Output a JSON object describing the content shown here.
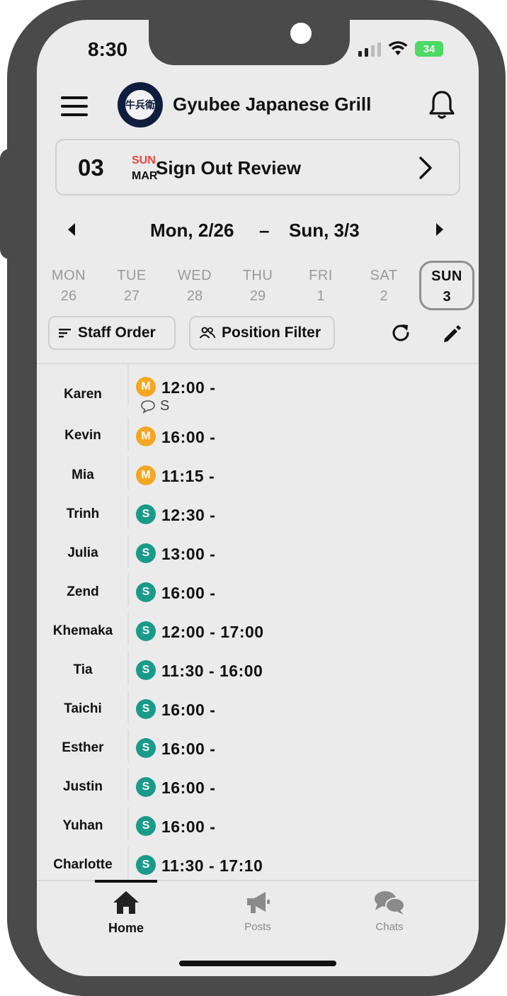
{
  "status_bar": {
    "time": "8:30",
    "battery": "34",
    "icons": [
      "signal-icon",
      "wifi-icon",
      "battery-icon"
    ]
  },
  "header": {
    "title": "Gyubee Japanese Grill",
    "logo_text": "牛兵衛",
    "icons": [
      "menu-icon",
      "bell-icon"
    ]
  },
  "signout": {
    "day": "03",
    "dow": "SUN",
    "month": "MAR",
    "label": "Sign Out Review"
  },
  "week": {
    "start": "Mon, 2/26",
    "dash": "–",
    "end": "Sun, 3/3"
  },
  "days": [
    {
      "name": "MON",
      "num": "26"
    },
    {
      "name": "TUE",
      "num": "27"
    },
    {
      "name": "WED",
      "num": "28"
    },
    {
      "name": "THU",
      "num": "29"
    },
    {
      "name": "FRI",
      "num": "1"
    },
    {
      "name": "SAT",
      "num": "2"
    },
    {
      "name": "SUN",
      "num": "3"
    }
  ],
  "toolbar": {
    "staff_order": "Staff Order",
    "position_filter": "Position Filter"
  },
  "roster": [
    {
      "name": "Karen",
      "badge": "M",
      "time": "12:00 -",
      "note": "S"
    },
    {
      "name": "Kevin",
      "badge": "M",
      "time": "16:00 -"
    },
    {
      "name": "Mia",
      "badge": "M",
      "time": "11:15 -"
    },
    {
      "name": "Trinh",
      "badge": "S",
      "time": "12:30 -"
    },
    {
      "name": "Julia",
      "badge": "S",
      "time": "13:00 -"
    },
    {
      "name": "Zend",
      "badge": "S",
      "time": "16:00 -"
    },
    {
      "name": "Khemaka",
      "badge": "S",
      "time": "12:00 - 17:00"
    },
    {
      "name": "Tia",
      "badge": "S",
      "time": "11:30 - 16:00"
    },
    {
      "name": "Taichi",
      "badge": "S",
      "time": "16:00 -"
    },
    {
      "name": "Esther",
      "badge": "S",
      "time": "16:00 -"
    },
    {
      "name": "Justin",
      "badge": "S",
      "time": "16:00 -"
    },
    {
      "name": "Yuhan",
      "badge": "S",
      "time": "16:00 -"
    },
    {
      "name": "Charlotte",
      "badge": "S",
      "time": "11:30 - 17:10"
    }
  ],
  "tabs": {
    "home": "Home",
    "posts": "Posts",
    "chats": "Chats"
  },
  "colors": {
    "manager_badge": "#f5a623",
    "staff_badge": "#1a9a8a",
    "sun_accent": "#e5483c",
    "battery": "#4cd964"
  }
}
